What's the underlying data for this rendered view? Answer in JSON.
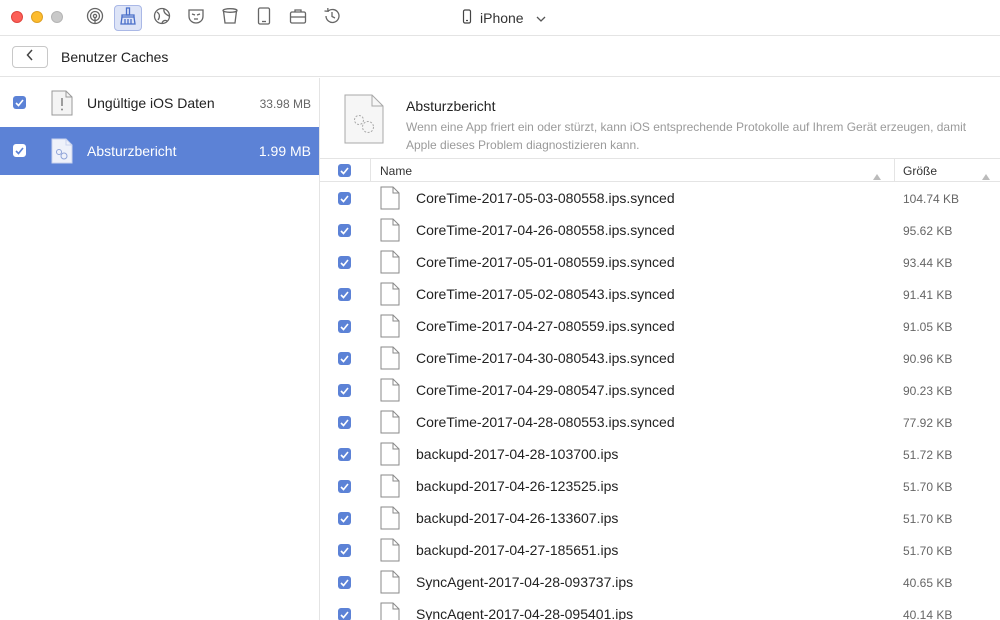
{
  "toolbar": {
    "tools": [
      {
        "name": "airbackup-icon",
        "active": false
      },
      {
        "name": "cleaner-icon",
        "active": true
      },
      {
        "name": "globe-icon",
        "active": false
      },
      {
        "name": "mask-icon",
        "active": false
      },
      {
        "name": "trash-icon",
        "active": false
      },
      {
        "name": "tablet-icon",
        "active": false
      },
      {
        "name": "toolbox-icon",
        "active": false
      },
      {
        "name": "history-icon",
        "active": false
      }
    ],
    "device_name": "iPhone"
  },
  "header": {
    "title": "Benutzer Caches"
  },
  "sidebar": {
    "items": [
      {
        "label": "Ungültige iOS Daten",
        "size": "33.98 MB",
        "checked": true,
        "selected": false
      },
      {
        "label": "Absturzbericht",
        "size": "1.99 MB",
        "checked": true,
        "selected": true
      }
    ]
  },
  "detail": {
    "title": "Absturzbericht",
    "description": "Wenn eine App friert ein oder stürzt, kann iOS entsprechende Protokolle auf Ihrem Gerät erzeugen, damit Apple dieses Problem diagnostizieren kann."
  },
  "table": {
    "columns": {
      "name": "Name",
      "size": "Größe"
    },
    "rows": [
      {
        "name": "CoreTime-2017-05-03-080558.ips.synced",
        "size": "104.74 KB"
      },
      {
        "name": "CoreTime-2017-04-26-080558.ips.synced",
        "size": "95.62 KB"
      },
      {
        "name": "CoreTime-2017-05-01-080559.ips.synced",
        "size": "93.44 KB"
      },
      {
        "name": "CoreTime-2017-05-02-080543.ips.synced",
        "size": "91.41 KB"
      },
      {
        "name": "CoreTime-2017-04-27-080559.ips.synced",
        "size": "91.05 KB"
      },
      {
        "name": "CoreTime-2017-04-30-080543.ips.synced",
        "size": "90.96 KB"
      },
      {
        "name": "CoreTime-2017-04-29-080547.ips.synced",
        "size": "90.23 KB"
      },
      {
        "name": "CoreTime-2017-04-28-080553.ips.synced",
        "size": "77.92 KB"
      },
      {
        "name": "backupd-2017-04-28-103700.ips",
        "size": "51.72 KB"
      },
      {
        "name": "backupd-2017-04-26-123525.ips",
        "size": "51.70 KB"
      },
      {
        "name": "backupd-2017-04-26-133607.ips",
        "size": "51.70 KB"
      },
      {
        "name": "backupd-2017-04-27-185651.ips",
        "size": "51.70 KB"
      },
      {
        "name": "SyncAgent-2017-04-28-093737.ips",
        "size": "40.65 KB"
      },
      {
        "name": "SyncAgent-2017-04-28-095401.ips",
        "size": "40.14 KB"
      }
    ]
  },
  "colors": {
    "accent": "#5c82d6",
    "close": "#fc5f57",
    "minimize": "#fdbc2e",
    "zoom": "#c9c9c9"
  }
}
